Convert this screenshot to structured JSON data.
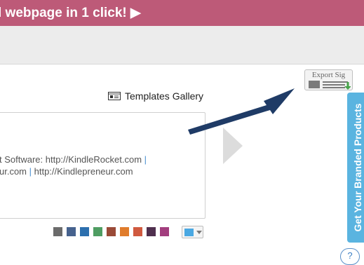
{
  "banner": {
    "text": "l webpage in 1 click! ▶"
  },
  "templates": {
    "icon": "gallery-icon",
    "label": "Templates Gallery"
  },
  "signature": {
    "line1_text": "t Software: http://KindleRocket.com",
    "line1_sep": " |",
    "line2_a": "ur.com",
    "line2_sep": " | ",
    "line2_b": "http://Kindlepreneur.com"
  },
  "swatches": [
    "#6b6b6b",
    "#46628e",
    "#2c6fae",
    "#4f9d62",
    "#9a4a37",
    "#e07c2c",
    "#d05a3f",
    "#4f2f4e",
    "#a23e7e"
  ],
  "color_picker": {
    "current": "#4aa8e2"
  },
  "export": {
    "label": "Export Sig",
    "icon": "export-signature-icon"
  },
  "side_tab": {
    "label": "Get Your Branded Products"
  },
  "help": {
    "label": "?"
  },
  "colors": {
    "banner": "#bd5a78",
    "arrow": "#1f3b66",
    "side_tab": "#5ab4e0"
  }
}
